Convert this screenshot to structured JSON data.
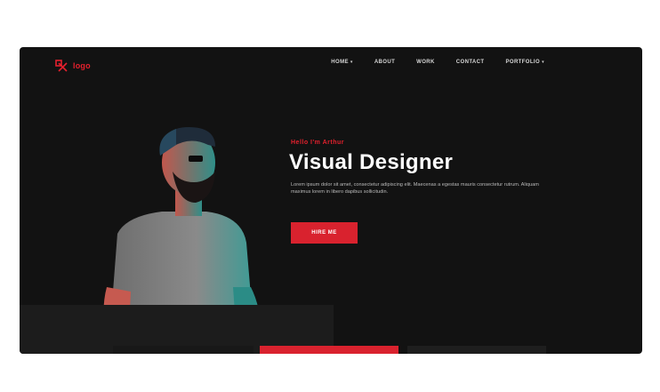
{
  "brand": {
    "name": "logo",
    "accent": "#e4202d",
    "logo_icon": "logo-mark-icon"
  },
  "nav": {
    "items": [
      {
        "label": "HOME",
        "dropdown": true
      },
      {
        "label": "ABOUT",
        "dropdown": false
      },
      {
        "label": "WORK",
        "dropdown": false
      },
      {
        "label": "CONTACT",
        "dropdown": false
      },
      {
        "label": "PORTFOLIO",
        "dropdown": true
      }
    ]
  },
  "hero": {
    "eyebrow": "Hello I'm Arthur",
    "headline": "Visual Designer",
    "description": "Lorem ipsum dolor sit amet, consectetur adipiscing elit. Maecenas a egestas mauris consectetur rutrum. Aliquam maximus lorem in libero dapibus sollicitudin.",
    "cta_label": "HIRE ME"
  },
  "colors": {
    "background": "#121212",
    "cta": "#d9222e",
    "text": "#ffffff"
  }
}
